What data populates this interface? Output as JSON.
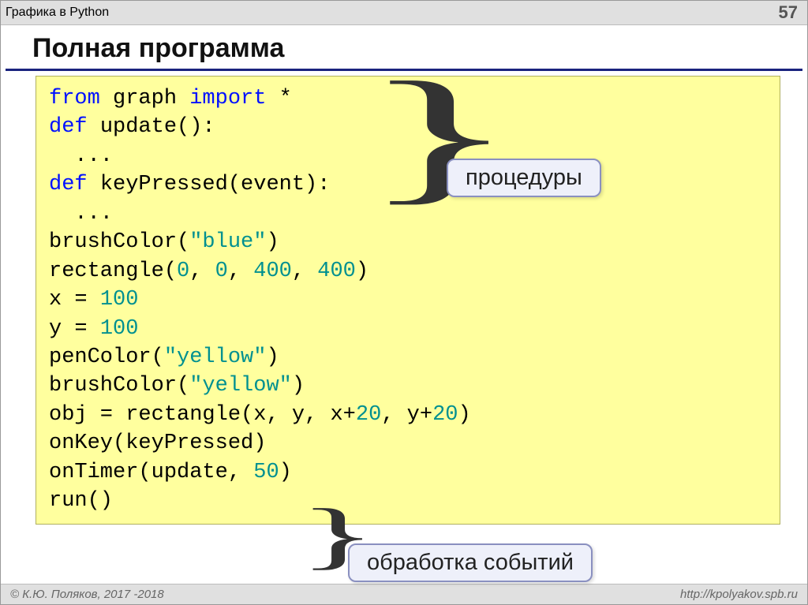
{
  "header": {
    "title": "Графика в Python",
    "page": "57"
  },
  "section_title": "Полная программа",
  "code": {
    "l1": {
      "a": "from",
      "b": "graph",
      "c": "import",
      "d": "*"
    },
    "l2": {
      "a": "def",
      "b": "update():"
    },
    "l3": "  ...",
    "l4": {
      "a": "def",
      "b": "keyPressed(event):"
    },
    "l5": "  ...",
    "l6": {
      "a": "brushColor(",
      "b": "\"blue\"",
      "c": ")"
    },
    "l7": {
      "a": "rectangle(",
      "b": "0",
      "c": ", ",
      "d": "0",
      "e": ", ",
      "f": "400",
      "g": ", ",
      "h": "400",
      "i": ")"
    },
    "l8": {
      "a": "x = ",
      "b": "100"
    },
    "l9": {
      "a": "y = ",
      "b": "100"
    },
    "l10": {
      "a": "penColor(",
      "b": "\"yellow\"",
      "c": ")"
    },
    "l11": {
      "a": "brushColor(",
      "b": "\"yellow\"",
      "c": ")"
    },
    "l12": {
      "a": "obj = rectangle(x, y, x+",
      "b": "20",
      "c": ", y+",
      "d": "20",
      "e": ")"
    },
    "l13": "onKey(keyPressed)",
    "l14": {
      "a": "onTimer(update, ",
      "b": "50",
      "c": ")"
    },
    "l15": "run()"
  },
  "callouts": {
    "procedures": "процедуры",
    "events": "обработка\nсобытий"
  },
  "footer": {
    "left": "© К.Ю. Поляков, 2017 -2018",
    "right": "http://kpolyakov.spb.ru"
  }
}
